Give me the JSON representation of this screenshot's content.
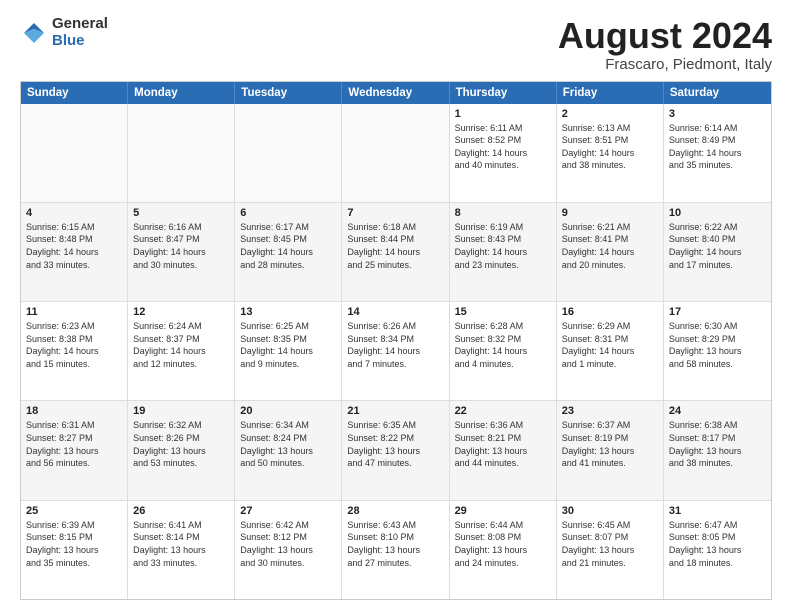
{
  "logo": {
    "general": "General",
    "blue": "Blue"
  },
  "title": "August 2024",
  "location": "Frascaro, Piedmont, Italy",
  "headers": [
    "Sunday",
    "Monday",
    "Tuesday",
    "Wednesday",
    "Thursday",
    "Friday",
    "Saturday"
  ],
  "rows": [
    [
      {
        "day": "",
        "text": "",
        "empty": true
      },
      {
        "day": "",
        "text": "",
        "empty": true
      },
      {
        "day": "",
        "text": "",
        "empty": true
      },
      {
        "day": "",
        "text": "",
        "empty": true
      },
      {
        "day": "1",
        "text": "Sunrise: 6:11 AM\nSunset: 8:52 PM\nDaylight: 14 hours\nand 40 minutes."
      },
      {
        "day": "2",
        "text": "Sunrise: 6:13 AM\nSunset: 8:51 PM\nDaylight: 14 hours\nand 38 minutes."
      },
      {
        "day": "3",
        "text": "Sunrise: 6:14 AM\nSunset: 8:49 PM\nDaylight: 14 hours\nand 35 minutes."
      }
    ],
    [
      {
        "day": "4",
        "text": "Sunrise: 6:15 AM\nSunset: 8:48 PM\nDaylight: 14 hours\nand 33 minutes."
      },
      {
        "day": "5",
        "text": "Sunrise: 6:16 AM\nSunset: 8:47 PM\nDaylight: 14 hours\nand 30 minutes."
      },
      {
        "day": "6",
        "text": "Sunrise: 6:17 AM\nSunset: 8:45 PM\nDaylight: 14 hours\nand 28 minutes."
      },
      {
        "day": "7",
        "text": "Sunrise: 6:18 AM\nSunset: 8:44 PM\nDaylight: 14 hours\nand 25 minutes."
      },
      {
        "day": "8",
        "text": "Sunrise: 6:19 AM\nSunset: 8:43 PM\nDaylight: 14 hours\nand 23 minutes."
      },
      {
        "day": "9",
        "text": "Sunrise: 6:21 AM\nSunset: 8:41 PM\nDaylight: 14 hours\nand 20 minutes."
      },
      {
        "day": "10",
        "text": "Sunrise: 6:22 AM\nSunset: 8:40 PM\nDaylight: 14 hours\nand 17 minutes."
      }
    ],
    [
      {
        "day": "11",
        "text": "Sunrise: 6:23 AM\nSunset: 8:38 PM\nDaylight: 14 hours\nand 15 minutes."
      },
      {
        "day": "12",
        "text": "Sunrise: 6:24 AM\nSunset: 8:37 PM\nDaylight: 14 hours\nand 12 minutes."
      },
      {
        "day": "13",
        "text": "Sunrise: 6:25 AM\nSunset: 8:35 PM\nDaylight: 14 hours\nand 9 minutes."
      },
      {
        "day": "14",
        "text": "Sunrise: 6:26 AM\nSunset: 8:34 PM\nDaylight: 14 hours\nand 7 minutes."
      },
      {
        "day": "15",
        "text": "Sunrise: 6:28 AM\nSunset: 8:32 PM\nDaylight: 14 hours\nand 4 minutes."
      },
      {
        "day": "16",
        "text": "Sunrise: 6:29 AM\nSunset: 8:31 PM\nDaylight: 14 hours\nand 1 minute."
      },
      {
        "day": "17",
        "text": "Sunrise: 6:30 AM\nSunset: 8:29 PM\nDaylight: 13 hours\nand 58 minutes."
      }
    ],
    [
      {
        "day": "18",
        "text": "Sunrise: 6:31 AM\nSunset: 8:27 PM\nDaylight: 13 hours\nand 56 minutes."
      },
      {
        "day": "19",
        "text": "Sunrise: 6:32 AM\nSunset: 8:26 PM\nDaylight: 13 hours\nand 53 minutes."
      },
      {
        "day": "20",
        "text": "Sunrise: 6:34 AM\nSunset: 8:24 PM\nDaylight: 13 hours\nand 50 minutes."
      },
      {
        "day": "21",
        "text": "Sunrise: 6:35 AM\nSunset: 8:22 PM\nDaylight: 13 hours\nand 47 minutes."
      },
      {
        "day": "22",
        "text": "Sunrise: 6:36 AM\nSunset: 8:21 PM\nDaylight: 13 hours\nand 44 minutes."
      },
      {
        "day": "23",
        "text": "Sunrise: 6:37 AM\nSunset: 8:19 PM\nDaylight: 13 hours\nand 41 minutes."
      },
      {
        "day": "24",
        "text": "Sunrise: 6:38 AM\nSunset: 8:17 PM\nDaylight: 13 hours\nand 38 minutes."
      }
    ],
    [
      {
        "day": "25",
        "text": "Sunrise: 6:39 AM\nSunset: 8:15 PM\nDaylight: 13 hours\nand 35 minutes."
      },
      {
        "day": "26",
        "text": "Sunrise: 6:41 AM\nSunset: 8:14 PM\nDaylight: 13 hours\nand 33 minutes."
      },
      {
        "day": "27",
        "text": "Sunrise: 6:42 AM\nSunset: 8:12 PM\nDaylight: 13 hours\nand 30 minutes."
      },
      {
        "day": "28",
        "text": "Sunrise: 6:43 AM\nSunset: 8:10 PM\nDaylight: 13 hours\nand 27 minutes."
      },
      {
        "day": "29",
        "text": "Sunrise: 6:44 AM\nSunset: 8:08 PM\nDaylight: 13 hours\nand 24 minutes."
      },
      {
        "day": "30",
        "text": "Sunrise: 6:45 AM\nSunset: 8:07 PM\nDaylight: 13 hours\nand 21 minutes."
      },
      {
        "day": "31",
        "text": "Sunrise: 6:47 AM\nSunset: 8:05 PM\nDaylight: 13 hours\nand 18 minutes."
      }
    ]
  ]
}
